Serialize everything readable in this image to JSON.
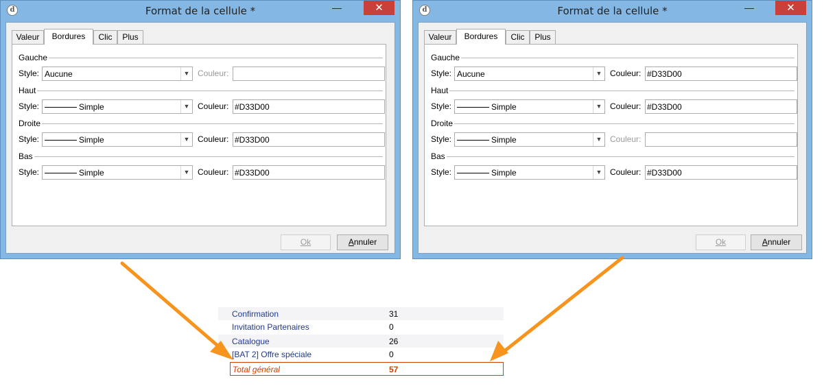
{
  "dialogs": [
    {
      "title": "Format de la cellule *",
      "minimize_glyph": "—",
      "close_glyph": "✕",
      "app_icon_glyph": "d",
      "tabs": [
        "Valeur",
        "Bordures",
        "Clic",
        "Plus"
      ],
      "active_tab": "Bordures",
      "sections": [
        {
          "heading": "Gauche",
          "style_label": "Style:",
          "style_value": "Aucune",
          "has_sample": false,
          "color_label": "Couleur:",
          "color_value": "",
          "color_disabled": true
        },
        {
          "heading": "Haut",
          "style_label": "Style:",
          "style_value": "Simple",
          "has_sample": true,
          "color_label": "Couleur:",
          "color_value": "#D33D00",
          "color_disabled": false
        },
        {
          "heading": "Droite",
          "style_label": "Style:",
          "style_value": "Simple",
          "has_sample": true,
          "color_label": "Couleur:",
          "color_value": "#D33D00",
          "color_disabled": false
        },
        {
          "heading": "Bas",
          "style_label": "Style:",
          "style_value": "Simple",
          "has_sample": true,
          "color_label": "Couleur:",
          "color_value": "#D33D00",
          "color_disabled": false
        }
      ],
      "ok_label": "Ok",
      "ok_disabled": true,
      "cancel_label_underlined": "A",
      "cancel_label_rest": "nnuler"
    },
    {
      "title": "Format de la cellule *",
      "minimize_glyph": "—",
      "close_glyph": "✕",
      "app_icon_glyph": "d",
      "tabs": [
        "Valeur",
        "Bordures",
        "Clic",
        "Plus"
      ],
      "active_tab": "Bordures",
      "sections": [
        {
          "heading": "Gauche",
          "style_label": "Style:",
          "style_value": "Aucune",
          "has_sample": false,
          "color_label": "Couleur:",
          "color_value": "#D33D00",
          "color_disabled": false
        },
        {
          "heading": "Haut",
          "style_label": "Style:",
          "style_value": "Simple",
          "has_sample": true,
          "color_label": "Couleur:",
          "color_value": "#D33D00",
          "color_disabled": false
        },
        {
          "heading": "Droite",
          "style_label": "Style:",
          "style_value": "Simple",
          "has_sample": true,
          "color_label": "Couleur:",
          "color_value": "",
          "color_disabled": true
        },
        {
          "heading": "Bas",
          "style_label": "Style:",
          "style_value": "Simple",
          "has_sample": true,
          "color_label": "Couleur:",
          "color_value": "#D33D00",
          "color_disabled": false
        }
      ],
      "ok_label": "Ok",
      "ok_disabled": true,
      "cancel_label_underlined": "A",
      "cancel_label_rest": "nnuler"
    }
  ],
  "report": {
    "rows": [
      {
        "name": "Confirmation",
        "value": "31"
      },
      {
        "name": "Invitation Partenaires",
        "value": "0"
      },
      {
        "name": "Catalogue",
        "value": "26"
      },
      {
        "name": "[BAT 2] Offre spéciale",
        "value": "0"
      }
    ],
    "total": {
      "name": "Total général",
      "value": "57"
    }
  },
  "colors": {
    "border_accent": "#D33D00",
    "arrow": "#F7941D",
    "link_text": "#1F3A8A",
    "window_frame": "#85B7E4",
    "close_button": "#C7413A"
  }
}
